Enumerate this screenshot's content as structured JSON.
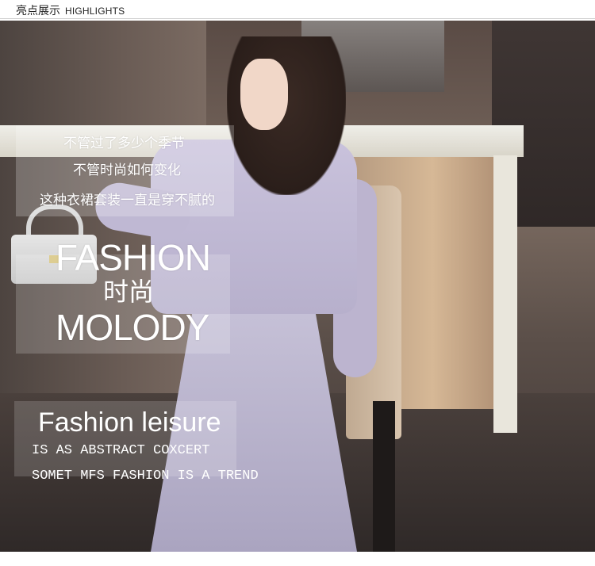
{
  "header": {
    "title_cn": "亮点展示",
    "title_en": "HIGHLIGHTS"
  },
  "overlay": {
    "lines_cn": [
      "不管过了多少个季节",
      "不管时尚如何变化",
      "这种衣裙套装一直是穿不腻的"
    ],
    "big_word_1": "FASHION",
    "big_word_cn": "时尚",
    "big_word_2": "MOLODY",
    "leisure_title": "Fashion leisure",
    "leisure_line_1": "IS AS ABSTRACT COXCERT",
    "leisure_line_2": "SOMET MFS FASHION IS A TREND"
  },
  "colors": {
    "suit": "#c4bdd8",
    "text_overlay": "#ffffff",
    "header_rule": "#cfcfcf"
  }
}
